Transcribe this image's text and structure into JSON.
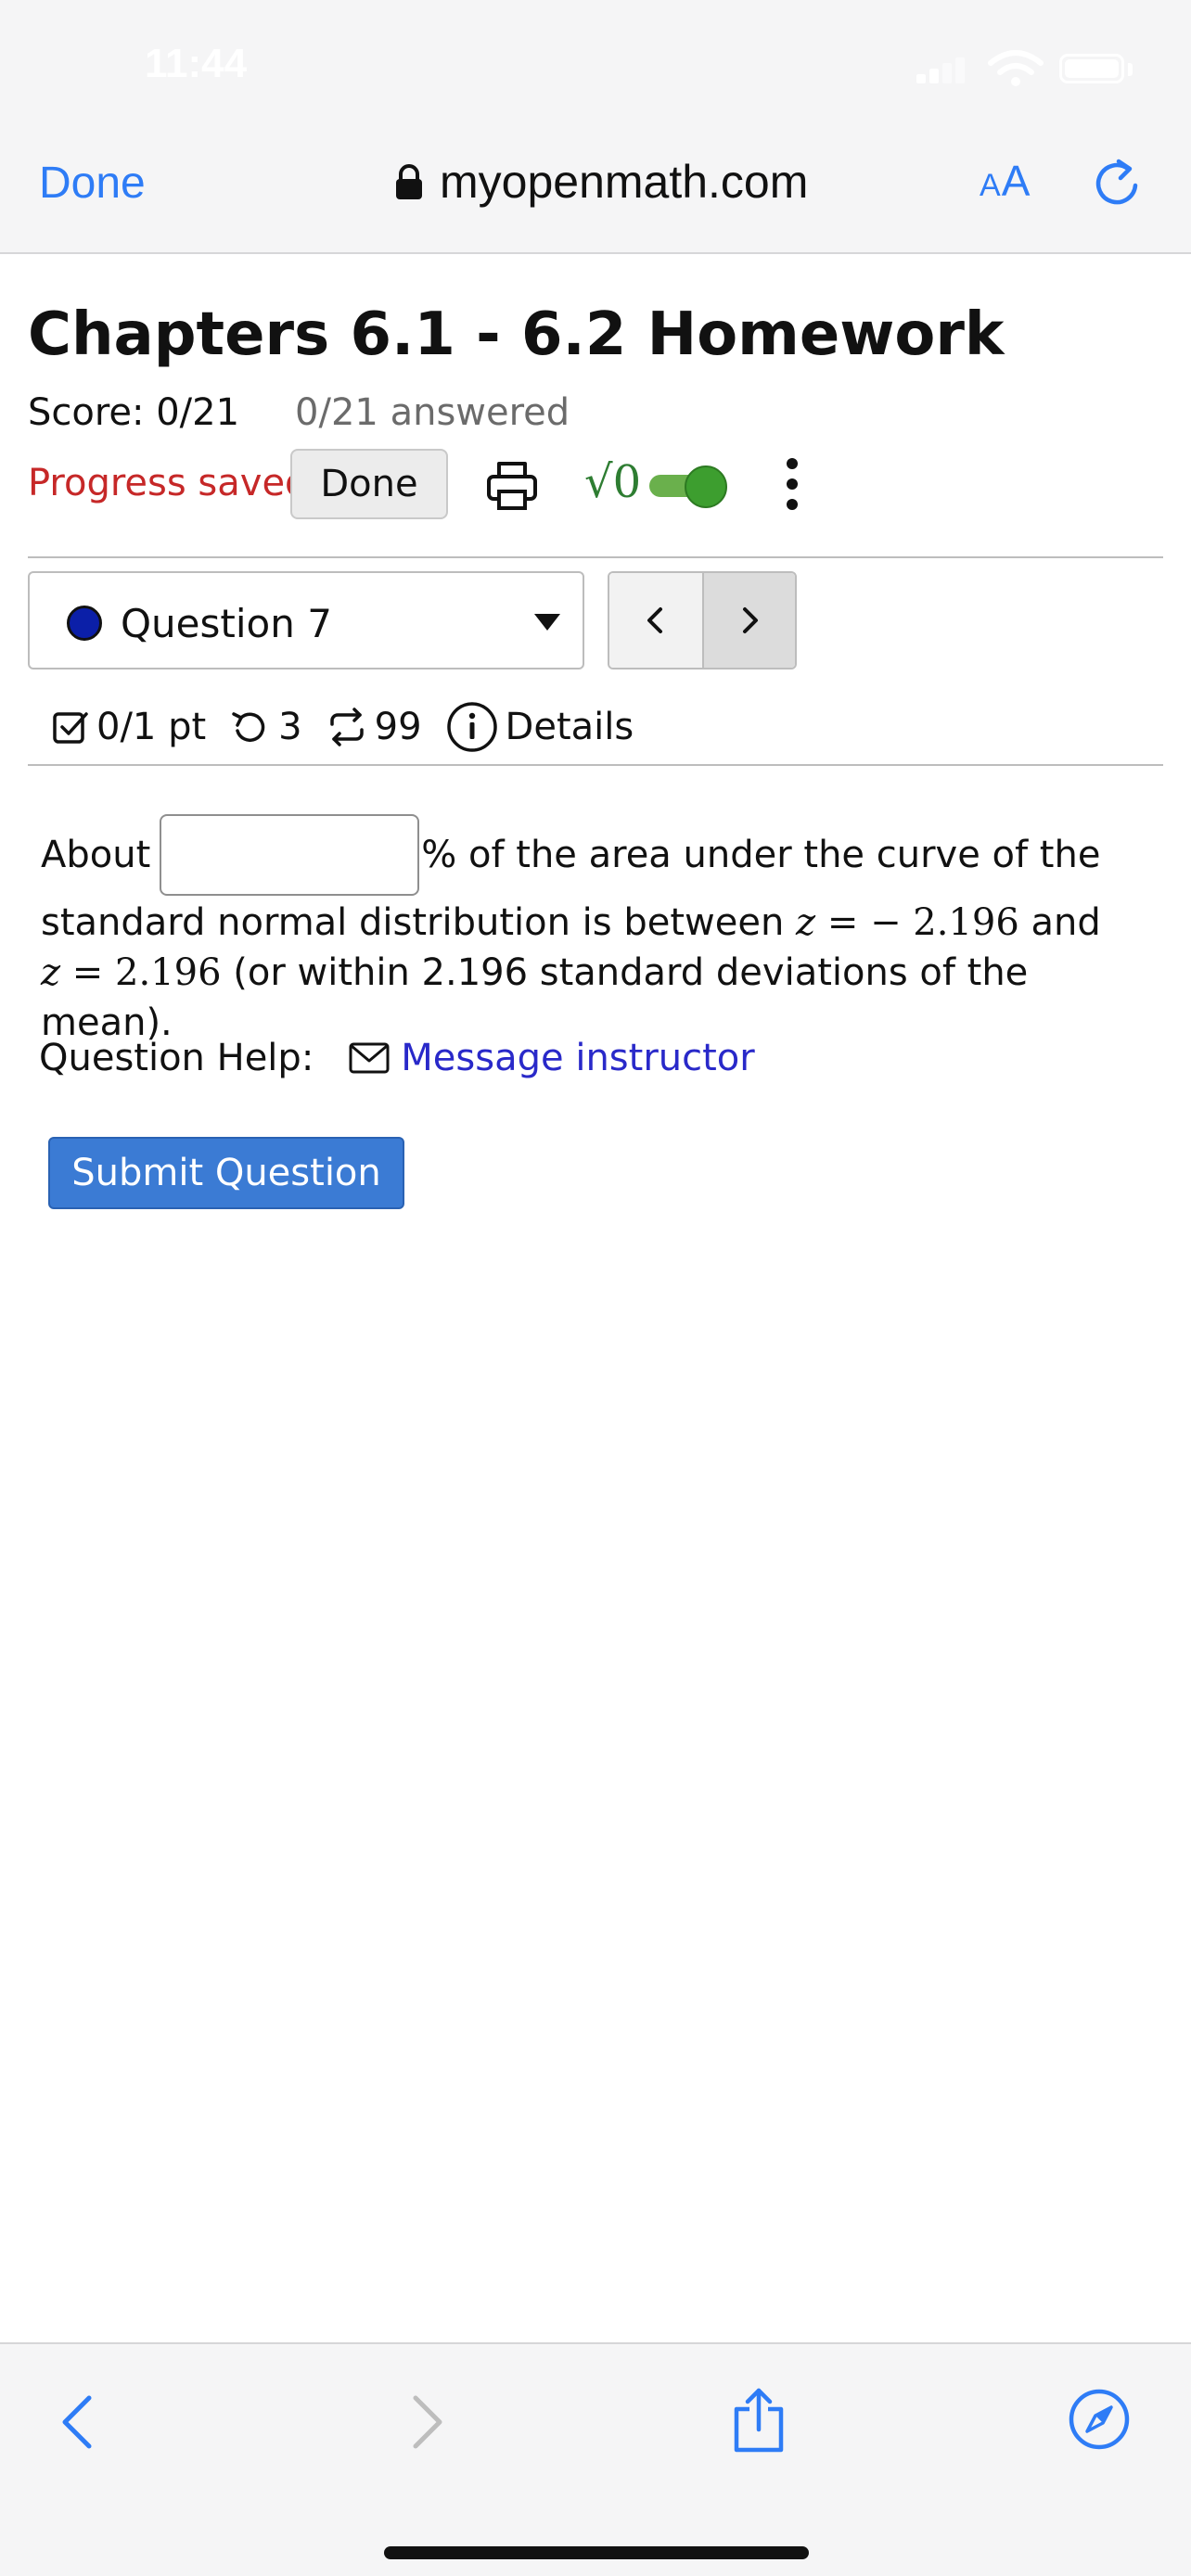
{
  "status_bar": {
    "time": "11:44"
  },
  "browser": {
    "done_label": "Done",
    "url": "myopenmath.com",
    "text_size_label_small": "A",
    "text_size_label_large": "A"
  },
  "page": {
    "title": "Chapters 6.1 - 6.2 Homework",
    "score": "Score: 0/21",
    "answered": "0/21 answered",
    "progress_saved": "Progress saved",
    "done_button": "Done",
    "sqrt_label": "√0"
  },
  "question_nav": {
    "selected": "Question 7",
    "prev_label": "<",
    "next_label": ">"
  },
  "meta": {
    "points": "0/1 pt",
    "attempts": "3",
    "versions": "99",
    "details": "Details"
  },
  "question": {
    "prefix": "About",
    "input_value": "",
    "line1_suffix": "% of the area under the curve of the",
    "line2_text": "standard normal distribution is between ",
    "z_var": "z",
    "equals": " = ",
    "neg_value": "− 2.196",
    "and_text": " and",
    "pos_value": "2.196",
    "tail": " (or within 2.196 standard deviations of the mean)."
  },
  "help": {
    "label": "Question Help:",
    "link": "Message instructor"
  },
  "submit_label": "Submit Question",
  "colors": {
    "accent": "#2e7cf6",
    "progress_saved": "#c62828",
    "submit": "#3b7bd4",
    "toggle": "#3d9e2f"
  }
}
